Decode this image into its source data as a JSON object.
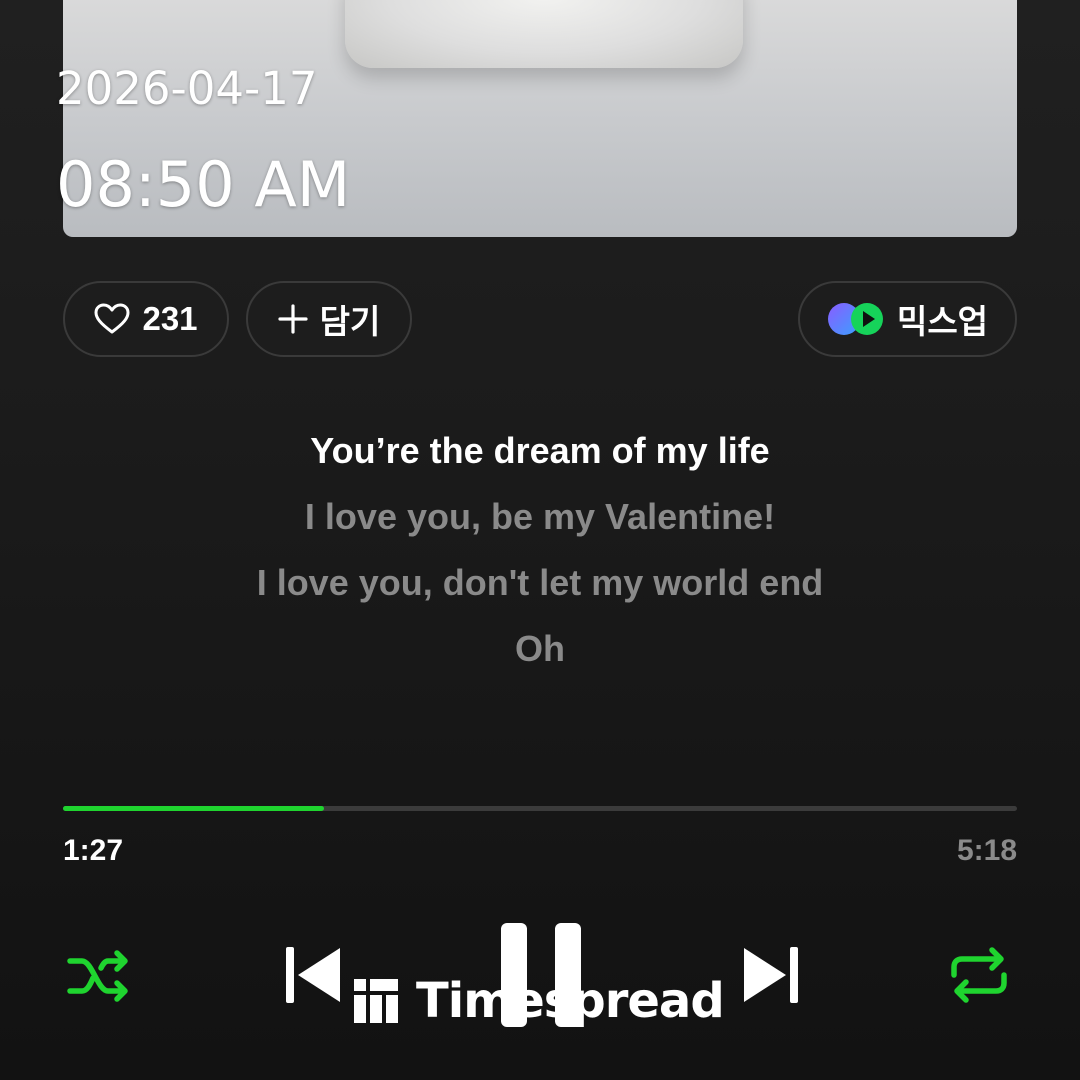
{
  "overlay": {
    "date": "2026-04-17",
    "time": "08:50 AM"
  },
  "actions": {
    "like_count": "231",
    "add_label": "담기",
    "mixup_label": "믹스업"
  },
  "lyrics": {
    "lines": [
      "You’re the dream of my life",
      "I love you, be my Valentine!",
      "I love you, don't let my world end",
      "Oh"
    ],
    "current_index": 0
  },
  "playback": {
    "elapsed": "1:27",
    "total": "5:18",
    "progress_fraction": 0.274,
    "state": "playing"
  },
  "controls": {
    "shuffle_icon": "shuffle-icon",
    "prev_icon": "skip-previous-icon",
    "pause_icon": "pause-icon",
    "next_icon": "skip-next-icon",
    "repeat_icon": "repeat-icon"
  },
  "colors": {
    "accent": "#1fd42f",
    "text_primary": "#ffffff",
    "text_secondary": "#8a8a8a"
  },
  "watermark": {
    "text": "Timespread"
  }
}
